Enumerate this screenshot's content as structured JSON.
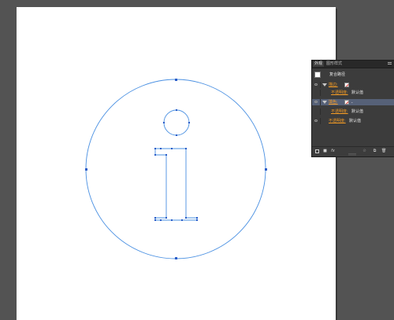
{
  "panel": {
    "tabs": [
      "外观",
      "图形样式"
    ],
    "object_title": "复合路径",
    "rows": [
      {
        "label": "描边:",
        "type": "stroke"
      },
      {
        "label": "不透明度:",
        "value": "默认值"
      },
      {
        "label": "填色:",
        "type": "fill"
      },
      {
        "label": "不透明度:",
        "value": "默认值"
      },
      {
        "label": "不透明度:",
        "value": "默认值"
      }
    ]
  },
  "colors": {
    "canvas_bg": "#535353",
    "artboard": "#ffffff",
    "path_outline": "#4a90e2",
    "anchor": "#2b5cc8",
    "panel_bg": "#3c3c3c",
    "selected_row": "#566178",
    "attribute_label": "#f19a25"
  },
  "icons": {
    "footer": [
      "new-stroke-icon",
      "new-fill-icon",
      "fx-icon",
      "clear-icon",
      "duplicate-icon",
      "delete-icon"
    ],
    "row": [
      "eye-icon",
      "disclosure-triangle-icon",
      "none-swatch-icon",
      "chevron-icon"
    ]
  }
}
